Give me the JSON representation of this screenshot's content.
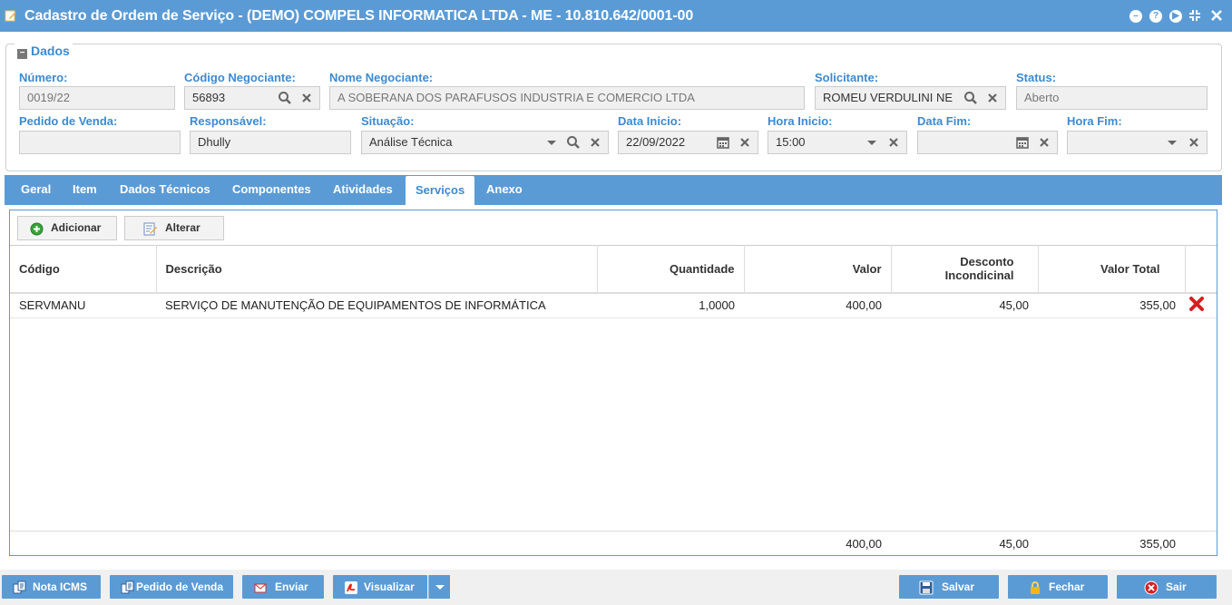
{
  "window": {
    "title": "Cadastro de Ordem de Serviço - (DEMO) COMPELS INFORMATICA LTDA - ME - 10.810.642/0001-00"
  },
  "section": {
    "legend": "Dados"
  },
  "fields": {
    "numero": {
      "label": "Número:",
      "value": "0019/22"
    },
    "codigo_negociante": {
      "label": "Código Negociante:",
      "value": "56893"
    },
    "nome_negociante": {
      "label": "Nome Negociante:",
      "value": "A SOBERANA DOS PARAFUSOS INDUSTRIA E COMERCIO LTDA"
    },
    "solicitante": {
      "label": "Solicitante:",
      "value": "ROMEU VERDULINI NE"
    },
    "status": {
      "label": "Status:",
      "value": "Aberto"
    },
    "pedido_venda": {
      "label": "Pedido de Venda:",
      "value": ""
    },
    "responsavel": {
      "label": "Responsável:",
      "value": "Dhully"
    },
    "situacao": {
      "label": "Situação:",
      "value": "Análise Técnica"
    },
    "data_inicio": {
      "label": "Data Inicio:",
      "value": "22/09/2022"
    },
    "hora_inicio": {
      "label": "Hora Inicio:",
      "value": "15:00"
    },
    "data_fim": {
      "label": "Data Fim:",
      "value": ""
    },
    "hora_fim": {
      "label": "Hora Fim:",
      "value": ""
    }
  },
  "tabs": [
    "Geral",
    "Item",
    "Dados Técnicos",
    "Componentes",
    "Atividades",
    "Serviços",
    "Anexo"
  ],
  "active_tab": "Serviços",
  "toolbar": {
    "add_label": "Adicionar",
    "edit_label": "Alterar"
  },
  "grid": {
    "columns": [
      "Código",
      "Descrição",
      "Quantidade",
      "Valor",
      "Desconto Incondicinal",
      "Valor Total"
    ],
    "rows": [
      {
        "codigo": "SERVMANU",
        "descricao": "SERVIÇO DE MANUTENÇÃO DE EQUIPAMENTOS DE INFORMÁTICA",
        "quantidade": "1,0000",
        "valor": "400,00",
        "desconto": "45,00",
        "valor_total": "355,00"
      }
    ],
    "totals": {
      "valor": "400,00",
      "desconto": "45,00",
      "valor_total": "355,00"
    }
  },
  "bottom": {
    "nota_icms": "Nota ICMS",
    "pedido_venda": "Pedido de Venda",
    "enviar": "Enviar",
    "visualizar": "Visualizar",
    "salvar": "Salvar",
    "fechar": "Fechar",
    "sair": "Sair"
  },
  "colors": {
    "accent": "#5b9bd5",
    "label": "#3d8ad0",
    "delete": "#d62020"
  }
}
